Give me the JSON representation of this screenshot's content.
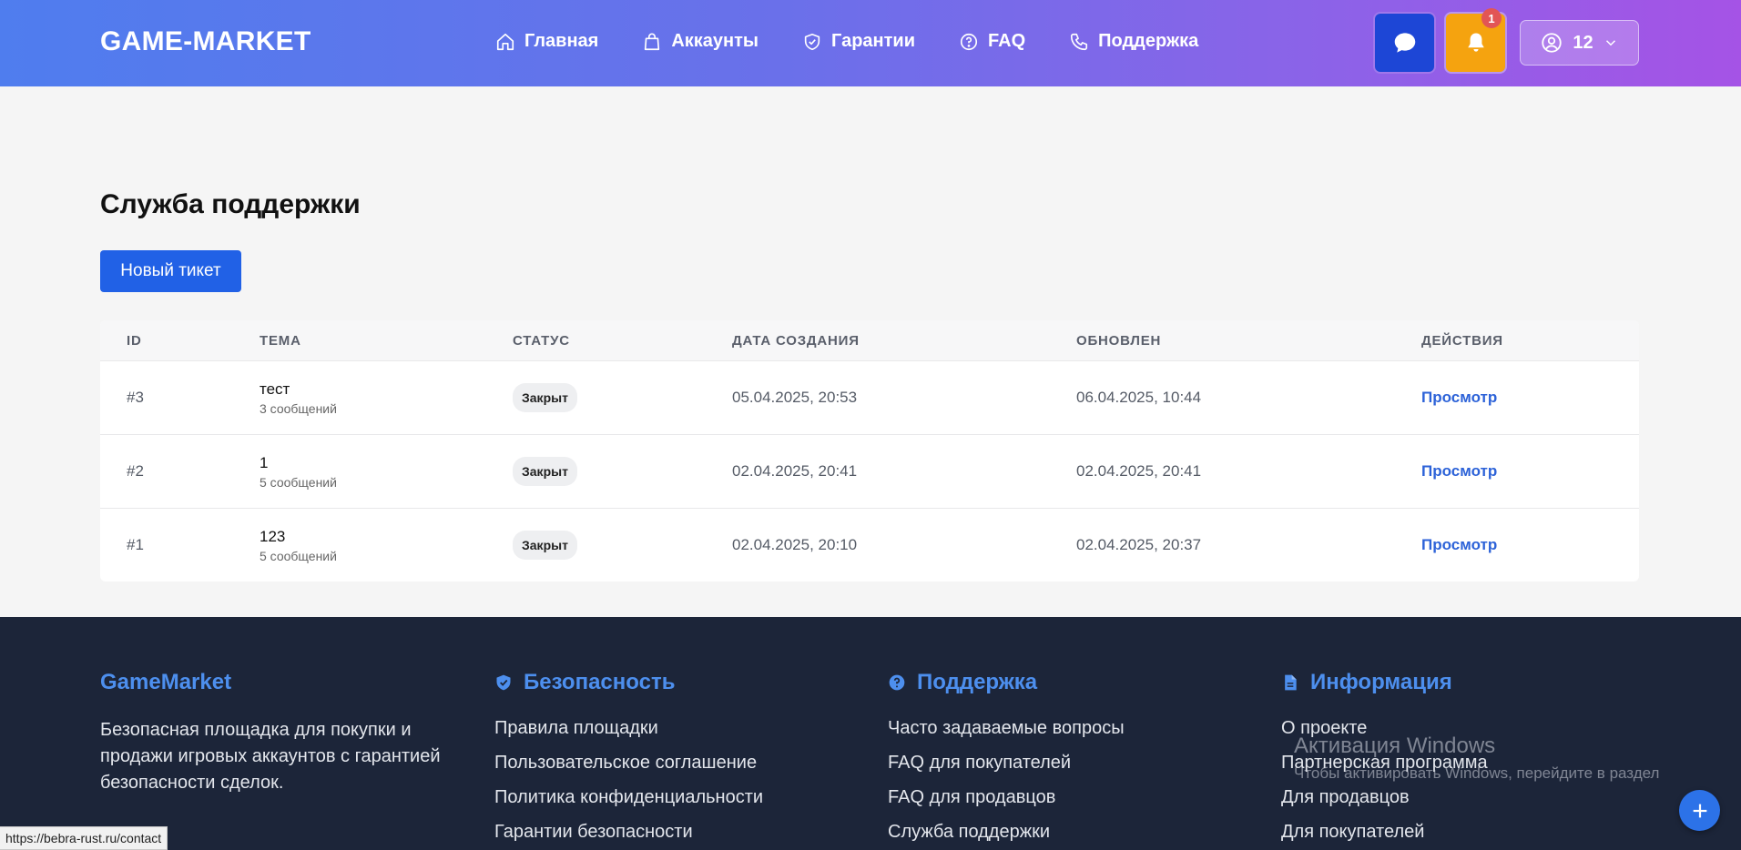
{
  "header": {
    "logo": "GAME-MARKET",
    "nav": [
      {
        "label": "Главная",
        "icon": "home-icon"
      },
      {
        "label": "Аккаунты",
        "icon": "bag-icon"
      },
      {
        "label": "Гарантии",
        "icon": "shield-icon"
      },
      {
        "label": "FAQ",
        "icon": "question-icon"
      },
      {
        "label": "Поддержка",
        "icon": "phone-icon"
      }
    ],
    "notification_count": "1",
    "user_label": "12",
    "colors": {
      "gradient_start": "#4f7dee",
      "gradient_end": "#a553e6",
      "chat": "#1d46d6",
      "bell": "#f5a30f"
    }
  },
  "main": {
    "title": "Служба поддержки",
    "new_ticket_label": "Новый тикет",
    "table": {
      "headers": {
        "id": "ID",
        "topic": "ТЕМА",
        "status": "СТАТУС",
        "created": "ДАТА СОЗДАНИЯ",
        "updated": "ОБНОВЛЕН",
        "actions": "ДЕЙСТВИЯ"
      },
      "rows": [
        {
          "id": "#3",
          "topic": "тест",
          "messages": "3 сообщений",
          "status": "Закрыт",
          "created": "05.04.2025, 20:53",
          "updated": "06.04.2025, 10:44",
          "action": "Просмотр"
        },
        {
          "id": "#2",
          "topic": "1",
          "messages": "5 сообщений",
          "status": "Закрыт",
          "created": "02.04.2025, 20:41",
          "updated": "02.04.2025, 20:41",
          "action": "Просмотр"
        },
        {
          "id": "#1",
          "topic": "123",
          "messages": "5 сообщений",
          "status": "Закрыт",
          "created": "02.04.2025, 20:10",
          "updated": "02.04.2025, 20:37",
          "action": "Просмотр"
        }
      ]
    }
  },
  "footer": {
    "brand": {
      "title": "GameMarket",
      "description": "Безопасная площадка для покупки и продажи игровых аккаунтов с гарантией безопасности сделок."
    },
    "security": {
      "title": "Безопасность",
      "links": [
        "Правила площадки",
        "Пользовательское соглашение",
        "Политика конфиденциальности",
        "Гарантии безопасности"
      ]
    },
    "support": {
      "title": "Поддержка",
      "links": [
        "Часто задаваемые вопросы",
        "FAQ для покупателей",
        "FAQ для продавцов",
        "Служба поддержки"
      ]
    },
    "info": {
      "title": "Информация",
      "links": [
        "О проекте",
        "Партнерская программа",
        "Для продавцов",
        "Для покупателей"
      ]
    },
    "accent": "#4d8fee"
  },
  "overlay": {
    "windows_title": "Активация Windows",
    "windows_text": "Чтобы активировать Windows, перейдите в раздел",
    "status_url": "https://bebra-rust.ru/contact"
  }
}
